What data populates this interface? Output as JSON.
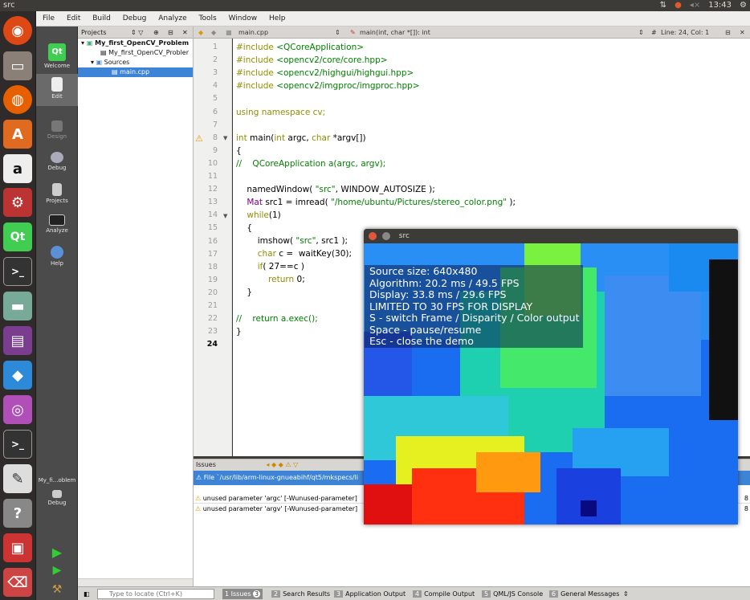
{
  "topbar": {
    "title": "src",
    "time": "13:43"
  },
  "menubar": {
    "file": "File",
    "edit": "Edit",
    "build": "Build",
    "debug": "Debug",
    "analyze": "Analyze",
    "tools": "Tools",
    "window": "Window",
    "help": "Help"
  },
  "modes": {
    "welcome": "Welcome",
    "edit": "Edit",
    "design": "Design",
    "debug": "Debug",
    "projects": "Projects",
    "analyze": "Analyze",
    "help": "Help",
    "target": "My_fi...oblem",
    "target_mode": "Debug"
  },
  "projects": {
    "header": "Projects",
    "root": "My_first_OpenCV_Problem",
    "pro": "My_first_OpenCV_Probler",
    "sources": "Sources",
    "file": "main.cpp"
  },
  "editor": {
    "filename": "main.cpp",
    "symbol": "main(int, char *[]): int",
    "position": "Line: 24, Col: 1"
  },
  "code": {
    "l1a": "#include ",
    "l1b": "<QCoreApplication>",
    "l2a": "#include ",
    "l2b": "<opencv2/core/core.hpp>",
    "l3a": "#include ",
    "l3b": "<opencv2/highgui/highgui.hpp>",
    "l4a": "#include ",
    "l4b": "<opencv2/imgproc/imgproc.hpp>",
    "l6a": "using namespace ",
    "l6b": "cv;",
    "l8a": "int ",
    "l8b": "main(",
    "l8c": "int ",
    "l8d": "argc, ",
    "l8e": "char ",
    "l8f": "*argv[])",
    "l9": "{",
    "l10": "//    QCoreApplication a(argc, argv);",
    "l12a": "    namedWindow( ",
    "l12b": "\"src\"",
    ",l12c": "",
    "l12c": ", WINDOW_AUTOSIZE );",
    "l13a": "    Mat ",
    "l13b": "src1 = imread( ",
    "l13c": "\"/home/ubuntu/Pictures/stereo_color.png\"",
    "l13d": " );",
    "l14a": "    ",
    "l14b": "while",
    "l14c": "(1)",
    "l15": "    {",
    "l16a": "        imshow( ",
    "l16b": "\"src\"",
    "l16c": ", src1 );",
    "l17a": "        ",
    "l17b": "char ",
    "l17c": "c =  waitKey(30);",
    "l18a": "        ",
    "l18b": "if",
    "l18c": "( 27==c )",
    "l19a": "            ",
    "l19b": "return ",
    "l19c": "0;",
    "l20": "    }",
    "l22": "//    return a.exec();",
    "l23": "}"
  },
  "issues": {
    "header": "Issues",
    "file_row": "File `/usr/lib/arm-linux-gnueabihf/qt5/mkspecs/li",
    "row1": "unused parameter 'argc' [-Wunused-parameter]",
    "row2": "unused parameter 'argv' [-Wunused-parameter]",
    "col8a": "8",
    "col8b": "8"
  },
  "statusbar": {
    "locate_placeholder": "Type to locate (Ctrl+K)",
    "t1n": "1",
    "t1": "Issues",
    "t1c": "3",
    "t2n": "2",
    "t2": "Search Results",
    "t3n": "3",
    "t3": "Application Output",
    "t4n": "4",
    "t4": "Compile Output",
    "t5n": "5",
    "t5": "QML/JS Console",
    "t6n": "6",
    "t6": "General Messages"
  },
  "srcwin": {
    "title": "src",
    "lines": [
      "Source size: 640x480",
      "Algorithm: 20.2 ms / 49.5 FPS",
      "Display: 33.8 ms / 29.6 FPS",
      "LIMITED TO 30 FPS FOR DISPLAY",
      "S - switch Frame / Disparity / Color output",
      "Space - pause/resume",
      "Esc - close the demo"
    ]
  }
}
